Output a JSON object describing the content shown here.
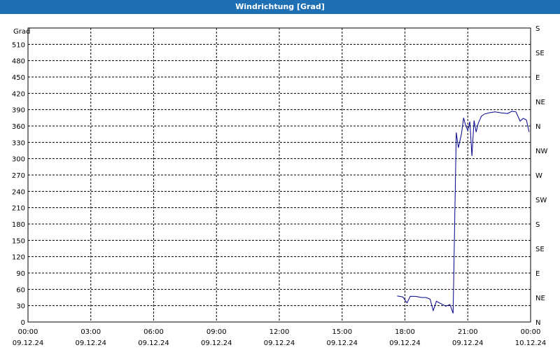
{
  "window": {
    "title": "Windrichtung [Grad]"
  },
  "chart_data": {
    "type": "line",
    "title": "Windrichtung [Grad]",
    "ylabel": "Grad",
    "xlabel": "",
    "ylim": [
      0,
      540
    ],
    "y_ticks": [
      0,
      30,
      60,
      90,
      120,
      150,
      180,
      210,
      240,
      270,
      300,
      330,
      360,
      390,
      420,
      450,
      480,
      510
    ],
    "x_range_hours": [
      0,
      24
    ],
    "x_ticks": [
      {
        "hour": 0,
        "time": "00:00",
        "date": "09.12.24"
      },
      {
        "hour": 3,
        "time": "03:00",
        "date": "09.12.24"
      },
      {
        "hour": 6,
        "time": "06:00",
        "date": "09.12.24"
      },
      {
        "hour": 9,
        "time": "09:00",
        "date": "09.12.24"
      },
      {
        "hour": 12,
        "time": "12:00",
        "date": "09.12.24"
      },
      {
        "hour": 15,
        "time": "15:00",
        "date": "09.12.24"
      },
      {
        "hour": 18,
        "time": "18:00",
        "date": "09.12.24"
      },
      {
        "hour": 21,
        "time": "21:00",
        "date": "09.12.24"
      },
      {
        "hour": 24,
        "time": "00:00",
        "date": "10.12.24"
      }
    ],
    "right_axis": [
      {
        "value": 0,
        "label": "N"
      },
      {
        "value": 45,
        "label": "NE"
      },
      {
        "value": 90,
        "label": "E"
      },
      {
        "value": 135,
        "label": "SE"
      },
      {
        "value": 180,
        "label": "S"
      },
      {
        "value": 225,
        "label": "SW"
      },
      {
        "value": 270,
        "label": "W"
      },
      {
        "value": 315,
        "label": "NW"
      },
      {
        "value": 360,
        "label": "N"
      },
      {
        "value": 405,
        "label": "NE"
      },
      {
        "value": 450,
        "label": "E"
      },
      {
        "value": 495,
        "label": "SE"
      },
      {
        "value": 540,
        "label": "S"
      }
    ],
    "grid": true,
    "colors": {
      "line": "#00008b",
      "grid": "#000000",
      "title_bar": "#1f6fb5"
    },
    "series": [
      {
        "x": [
          17.63,
          17.9,
          18.1,
          18.25,
          18.5,
          18.8,
          19.0,
          19.2,
          19.35,
          19.5,
          19.7,
          19.95,
          20.15,
          20.3,
          20.45,
          20.55,
          20.7,
          20.8,
          20.9,
          21.0,
          21.1,
          21.2,
          21.3,
          21.4,
          21.5,
          21.65,
          21.8,
          22.0,
          22.3,
          22.6,
          22.9,
          23.1,
          23.3,
          23.5,
          23.65,
          23.8,
          23.93
        ],
        "y": [
          48,
          46,
          35,
          47,
          47,
          45,
          45,
          42,
          21,
          38,
          34,
          29,
          32,
          16,
          348,
          320,
          346,
          375,
          360,
          352,
          368,
          305,
          370,
          349,
          365,
          378,
          382,
          384,
          386,
          384,
          383,
          387,
          386,
          369,
          374,
          371,
          349
        ]
      }
    ]
  }
}
